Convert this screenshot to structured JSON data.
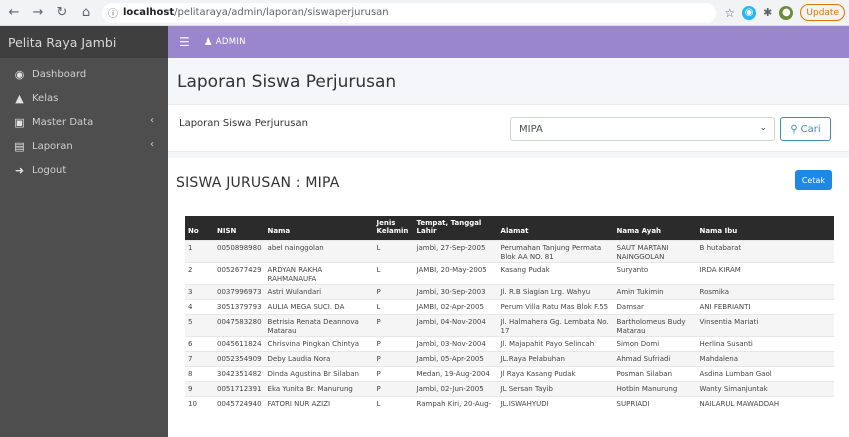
{
  "browser": {
    "url_host": "localhost",
    "url_path": "/pelitaraya/admin/laporan/siswaperjurusan",
    "update_label": "Update"
  },
  "sidebar": {
    "brand": "Pelita Raya Jambi",
    "items": [
      {
        "label": "Dashboard",
        "icon": "dashboard-icon"
      },
      {
        "label": "Kelas",
        "icon": "kelas-icon"
      },
      {
        "label": "Master Data",
        "icon": "database-icon",
        "has_chevron": true
      },
      {
        "label": "Laporan",
        "icon": "print-icon",
        "has_chevron": true
      },
      {
        "label": "Logout",
        "icon": "logout-icon"
      }
    ]
  },
  "topbar": {
    "user": "ADMIN"
  },
  "page": {
    "title": "Laporan Siswa Perjurusan",
    "filter_label": "Laporan Siswa Perjurusan",
    "selected_jurusan": "MIPA",
    "search_label": "Cari",
    "section_title": "SISWA JURUSAN : MIPA",
    "print_label": "Cetak"
  },
  "table": {
    "headers": {
      "no": "No",
      "nisn": "NISN",
      "nama": "Nama",
      "jk_line1": "Jenis",
      "jk_line2": "Kelamin",
      "ttl": "Tempat, Tanggal Lahir",
      "alamat": "Alamat",
      "ayah": "Nama Ayah",
      "ibu": "Nama Ibu"
    },
    "rows": [
      {
        "no": "1",
        "nisn": "0050898980",
        "nama": "abel nainggolan",
        "jk": "L",
        "ttl": "jambi, 27-Sep-2005",
        "alamat": "Perumahan Tanjung Permata Blok AA NO. 81",
        "ayah": "SAUT MARTANI NAINGGOLAN",
        "ibu": "B hutabarat"
      },
      {
        "no": "2",
        "nisn": "0052677429",
        "nama": "ARDYAN RAKHA RAHMANAUFA",
        "jk": "L",
        "ttl": "JAMBI, 20-May-2005",
        "alamat": "Kasang Pudak",
        "ayah": "Suryanto",
        "ibu": "IRDA KIRAM"
      },
      {
        "no": "3",
        "nisn": "0037996973",
        "nama": "Astri Wulandari",
        "jk": "P",
        "ttl": "Jambi, 30-Sep-2003",
        "alamat": "Jl. R.B Siagian Lrg. Wahyu",
        "ayah": "Amin Tukimin",
        "ibu": "Rosmika"
      },
      {
        "no": "4",
        "nisn": "3051379793",
        "nama": "AULIA MEGA SUCI. DA",
        "jk": "L",
        "ttl": "JAMBI, 02-Apr-2005",
        "alamat": "Perum Villa Ratu Mas Blok F.55",
        "ayah": "Damsar",
        "ibu": "ANI FEBRIANTI"
      },
      {
        "no": "5",
        "nisn": "0047583280",
        "nama": "Betrisia Renata Deannova Matarau",
        "jk": "P",
        "ttl": "Jambi, 04-Nov-2004",
        "alamat": "Jl. Halmahera Gg. Lembata No. 17",
        "ayah": "Bartholomeus Budy Matarau",
        "ibu": "Vinsentia Mariati"
      },
      {
        "no": "6",
        "nisn": "0045611824",
        "nama": "Chrisvina Pingkan Chintya",
        "jk": "P",
        "ttl": "Jambi, 03-Nov-2004",
        "alamat": "Jl. Majapahit Payo Selincah",
        "ayah": "Simon Domi",
        "ibu": "Herlina Susanti"
      },
      {
        "no": "7",
        "nisn": "0052354909",
        "nama": "Deby Laudia Nora",
        "jk": "P",
        "ttl": "Jambi, 05-Apr-2005",
        "alamat": "JL.Raya Pelabuhan",
        "ayah": "Ahmad Sufriadi",
        "ibu": "Mahdalena"
      },
      {
        "no": "8",
        "nisn": "3042351482",
        "nama": "Dinda Agustina Br Silaban",
        "jk": "P",
        "ttl": "Medan, 19-Aug-2004",
        "alamat": "Jl Raya Kasang Pudak",
        "ayah": "Posman Silaban",
        "ibu": "Asdina Lumban Gaol"
      },
      {
        "no": "9",
        "nisn": "0051712391",
        "nama": "Eka Yunita Br. Manurung",
        "jk": "P",
        "ttl": "Jambi, 02-Jun-2005",
        "alamat": "JL Sersan Tayib",
        "ayah": "Hotbin Manurung",
        "ibu": "Wanty Simanjuntak"
      },
      {
        "no": "10",
        "nisn": "0045724940",
        "nama": "FATORI NUR AZIZI",
        "jk": "L",
        "ttl": "Rampah Kiri, 20-Aug-",
        "alamat": "JL.ISWAHYUDI",
        "ayah": "SUPRIADI",
        "ibu": "NAILARUL MAWADDAH"
      }
    ]
  }
}
